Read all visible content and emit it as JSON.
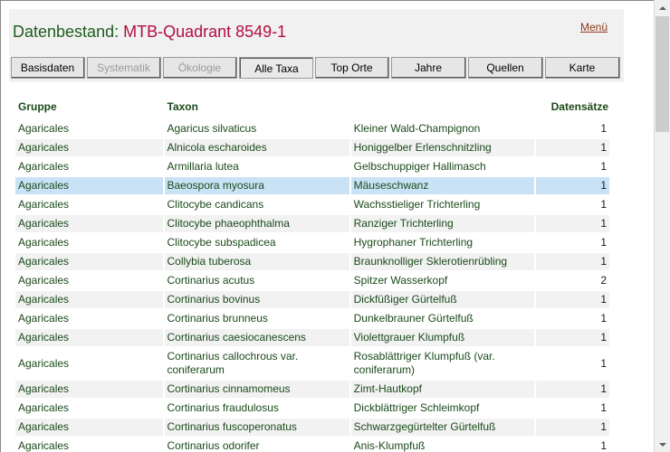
{
  "header": {
    "title_prefix": "Datenbestand:",
    "title_quadrant": "MTB-Quadrant 8549-1",
    "menu_label": "Menü"
  },
  "tabs": [
    {
      "label": "Basisdaten",
      "state": "normal"
    },
    {
      "label": "Systematik",
      "state": "disabled"
    },
    {
      "label": "Ökologie",
      "state": "disabled"
    },
    {
      "label": "Alle Taxa",
      "state": "active"
    },
    {
      "label": "Top Orte",
      "state": "normal"
    },
    {
      "label": "Jahre",
      "state": "normal"
    },
    {
      "label": "Quellen",
      "state": "normal"
    },
    {
      "label": "Karte",
      "state": "normal"
    }
  ],
  "table": {
    "headers": {
      "gruppe": "Gruppe",
      "taxon": "Taxon",
      "deutsch": "",
      "datensaetze": "Datensätze"
    },
    "selected_row": 3,
    "rows": [
      {
        "gruppe": "Agaricales",
        "taxon": "Agaricus silvaticus",
        "deutsch": "Kleiner Wald-Champignon",
        "count": "1"
      },
      {
        "gruppe": "Agaricales",
        "taxon": "Alnicola escharoides",
        "deutsch": "Honiggelber Erlenschnitzling",
        "count": "1"
      },
      {
        "gruppe": "Agaricales",
        "taxon": "Armillaria lutea",
        "deutsch": "Gelbschuppiger Hallimasch",
        "count": "1"
      },
      {
        "gruppe": "Agaricales",
        "taxon": "Baeospora myosura",
        "deutsch": "Mäuseschwanz",
        "count": "1"
      },
      {
        "gruppe": "Agaricales",
        "taxon": "Clitocybe candicans",
        "deutsch": "Wachsstieliger Trichterling",
        "count": "1"
      },
      {
        "gruppe": "Agaricales",
        "taxon": "Clitocybe phaeophthalma",
        "deutsch": "Ranziger Trichterling",
        "count": "1"
      },
      {
        "gruppe": "Agaricales",
        "taxon": "Clitocybe subspadicea",
        "deutsch": "Hygrophaner Trichterling",
        "count": "1"
      },
      {
        "gruppe": "Agaricales",
        "taxon": "Collybia tuberosa",
        "deutsch": "Braunknolliger Sklerotienrübling",
        "count": "1"
      },
      {
        "gruppe": "Agaricales",
        "taxon": "Cortinarius acutus",
        "deutsch": "Spitzer Wasserkopf",
        "count": "2"
      },
      {
        "gruppe": "Agaricales",
        "taxon": "Cortinarius bovinus",
        "deutsch": "Dickfüßiger Gürtelfuß",
        "count": "1"
      },
      {
        "gruppe": "Agaricales",
        "taxon": "Cortinarius brunneus",
        "deutsch": "Dunkelbrauner Gürtelfuß",
        "count": "1"
      },
      {
        "gruppe": "Agaricales",
        "taxon": "Cortinarius caesiocanescens",
        "deutsch": "Violettgrauer Klumpfuß",
        "count": "1"
      },
      {
        "gruppe": "Agaricales",
        "taxon": "Cortinarius callochrous var. coniferarum",
        "deutsch": "Rosablättriger Klumpfuß (var. coniferarum)",
        "count": "1"
      },
      {
        "gruppe": "Agaricales",
        "taxon": "Cortinarius cinnamomeus",
        "deutsch": "Zimt-Hautkopf",
        "count": "1"
      },
      {
        "gruppe": "Agaricales",
        "taxon": "Cortinarius fraudulosus",
        "deutsch": "Dickblättriger Schleimkopf",
        "count": "1"
      },
      {
        "gruppe": "Agaricales",
        "taxon": "Cortinarius fuscoperonatus",
        "deutsch": "Schwarzgegürtelter Gürtelfuß",
        "count": "1"
      },
      {
        "gruppe": "Agaricales",
        "taxon": "Cortinarius odorifer",
        "deutsch": "Anis-Klumpfuß",
        "count": "1"
      }
    ]
  },
  "icons": {
    "scroll_up": "arrow-up-icon",
    "scroll_down": "arrow-down-icon"
  }
}
